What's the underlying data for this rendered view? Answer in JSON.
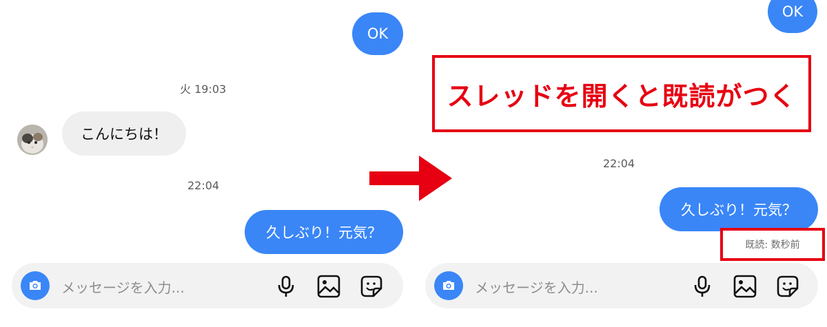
{
  "left_panel": {
    "ok_bubble": "OK",
    "timestamp_1": "火 19:03",
    "received_message": "こんにちは！",
    "timestamp_2": "22:04",
    "sent_message": "久しぶり！元気？",
    "composer_placeholder": "メッセージを入力..."
  },
  "right_panel": {
    "ok_bubble": "OK",
    "callout_text": "スレッドを開くと既読がつく",
    "timestamp": "22:04",
    "sent_message": "久しぶり！元気？",
    "read_receipt": "既読: 数秒前",
    "composer_placeholder": "メッセージを入力..."
  },
  "icons": {
    "camera": "camera-icon",
    "microphone": "microphone-icon",
    "gallery": "gallery-icon",
    "sticker": "sticker-icon",
    "arrow": "right-arrow-icon"
  },
  "colors": {
    "sent_bubble": "#3a86f7",
    "received_bubble": "#efefef",
    "highlight": "#e60012",
    "composer_bg": "#f2f2f3"
  }
}
